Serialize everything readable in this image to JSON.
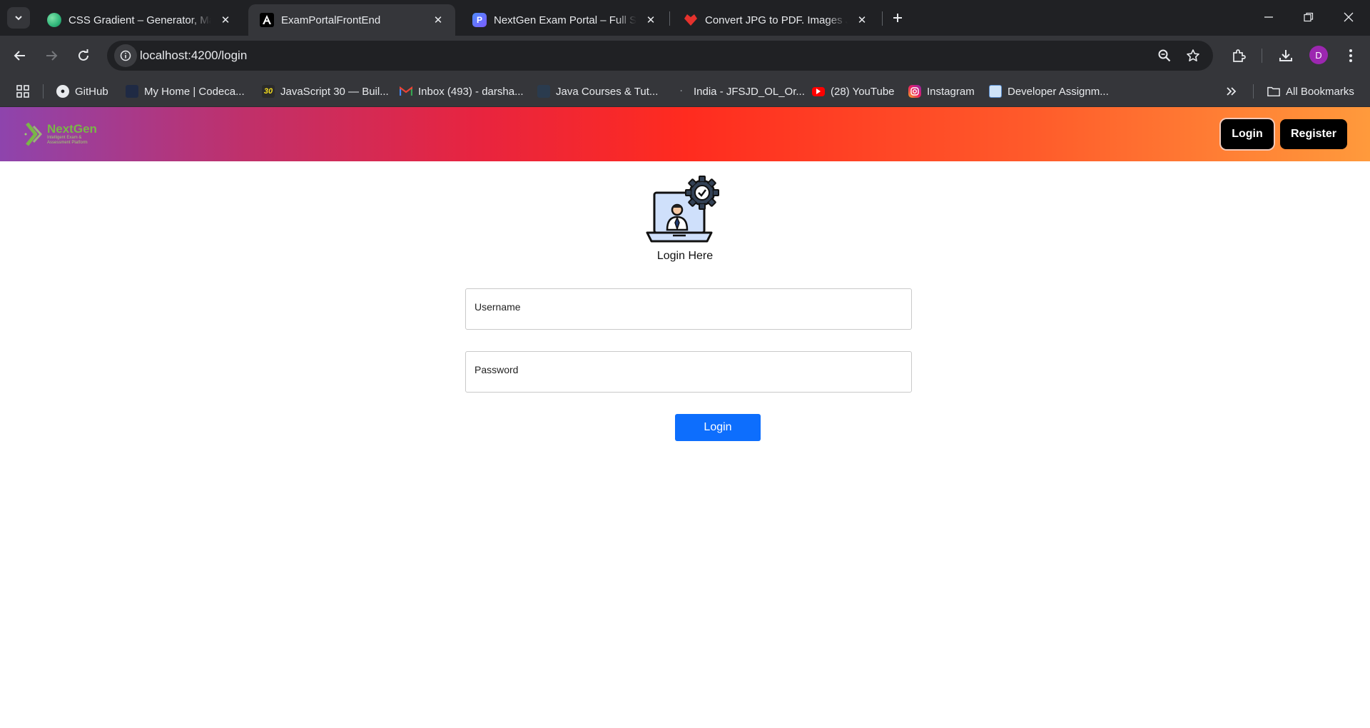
{
  "browser": {
    "tabs": [
      {
        "title": "CSS Gradient – Generator, Maker, and More",
        "active": false,
        "favicon": "css-gradient-favicon"
      },
      {
        "title": "ExamPortalFrontEnd",
        "active": true,
        "favicon": "angular-favicon"
      },
      {
        "title": "NextGen Exam Portal – Full Stack",
        "active": false,
        "favicon": "perplexity-favicon"
      },
      {
        "title": "Convert JPG to PDF. Images JPG to PDF",
        "active": false,
        "favicon": "ilovepdf-favicon"
      }
    ],
    "url": "localhost:4200/login",
    "profile_initial": "D",
    "bookmarks": [
      {
        "label": "GitHub",
        "icon": "github-icon"
      },
      {
        "label": "My Home | Codeca...",
        "icon": "codecademy-icon"
      },
      {
        "label": "JavaScript 30 — Buil...",
        "icon": "js30-icon"
      },
      {
        "label": "Inbox (493) - darsha...",
        "icon": "gmail-icon"
      },
      {
        "label": "Java Courses & Tut...",
        "icon": "java-icon"
      },
      {
        "label": "India - JFSJD_OL_Or...",
        "icon": "globe-icon"
      },
      {
        "label": "(28) YouTube",
        "icon": "youtube-icon"
      },
      {
        "label": "Instagram",
        "icon": "instagram-icon"
      },
      {
        "label": "Developer Assignm...",
        "icon": "assignment-icon"
      }
    ],
    "all_bookmarks": "All Bookmarks",
    "colors": {
      "frame": "#202124",
      "toolbar": "#35363a"
    }
  },
  "app": {
    "brand": {
      "name": "NextGen",
      "tagline": "Intelligent Exam & Assessment Platform"
    },
    "nav": {
      "login": "Login",
      "register": "Register"
    },
    "gradient": [
      "#8e44ad",
      "#ff2b1f",
      "#ff9a3c"
    ]
  },
  "login": {
    "title": "Login Here",
    "username_label": "Username",
    "password_label": "Password",
    "submit": "Login",
    "accent": "#0d6efd"
  }
}
